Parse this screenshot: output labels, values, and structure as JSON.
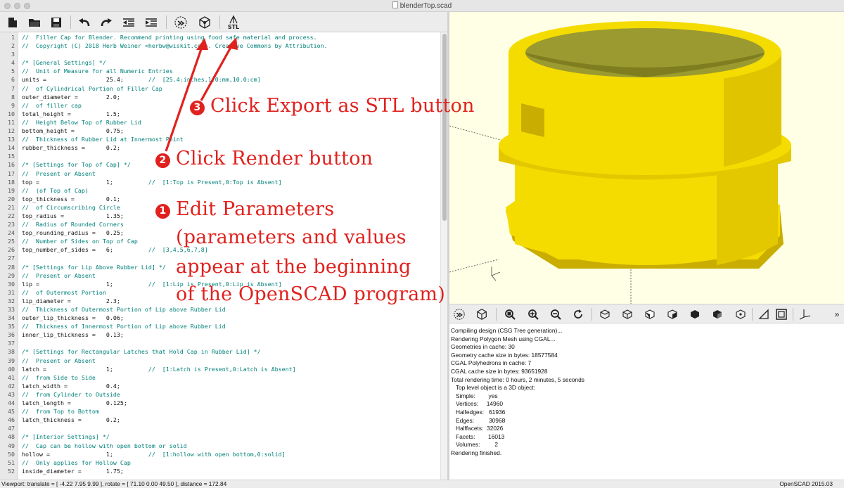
{
  "window": {
    "title": "blenderTop.scad"
  },
  "toolbar": {
    "stl_label": "STL"
  },
  "editor": {
    "lines": [
      {
        "n": "1",
        "code": "",
        "comment": "//  Filler Cap for Blender. Recommend printing using food safe material and process."
      },
      {
        "n": "2",
        "code": "",
        "comment": "//  Copyright (C) 2018 Herb Weiner <herbw@wiskit.com>. Creative Commons by Attribution."
      },
      {
        "n": "3",
        "code": "",
        "comment": ""
      },
      {
        "n": "4",
        "code": "",
        "comment": "/* [General Settings] */"
      },
      {
        "n": "5",
        "code": "",
        "comment": "//  Unit of Measure for all Numeric Entries"
      },
      {
        "n": "6",
        "code": "units =                 25.4;       ",
        "comment": "//  [25.4:inches,1.0:mm,10.0:cm]"
      },
      {
        "n": "7",
        "code": "",
        "comment": "//  of Cylindrical Portion of Filler Cap"
      },
      {
        "n": "8",
        "code": "outer_diameter =        2.0;",
        "comment": ""
      },
      {
        "n": "9",
        "code": "",
        "comment": "//  of filler cap"
      },
      {
        "n": "10",
        "code": "total_height =          1.5;",
        "comment": ""
      },
      {
        "n": "11",
        "code": "",
        "comment": "//  Height Below Top of Rubber Lid"
      },
      {
        "n": "12",
        "code": "bottom_height =         0.75;",
        "comment": ""
      },
      {
        "n": "13",
        "code": "",
        "comment": "//  Thickness of Rubber Lid at Innermost Point"
      },
      {
        "n": "14",
        "code": "rubber_thickness =      0.2;",
        "comment": ""
      },
      {
        "n": "15",
        "code": "",
        "comment": ""
      },
      {
        "n": "16",
        "code": "",
        "comment": "/* [Settings for Top of Cap] */"
      },
      {
        "n": "17",
        "code": "",
        "comment": "//  Present or Absent"
      },
      {
        "n": "18",
        "code": "top =                   1;          ",
        "comment": "//  [1:Top is Present,0:Top is Absent]"
      },
      {
        "n": "19",
        "code": "",
        "comment": "//  (of Top of Cap)"
      },
      {
        "n": "20",
        "code": "top_thickness =         0.1;",
        "comment": ""
      },
      {
        "n": "21",
        "code": "",
        "comment": "//  of Circumscribing Circle"
      },
      {
        "n": "22",
        "code": "top_radius =            1.35;",
        "comment": ""
      },
      {
        "n": "23",
        "code": "",
        "comment": "//  Radius of Rounded Corners"
      },
      {
        "n": "24",
        "code": "top_rounding_radius =   0.25;",
        "comment": ""
      },
      {
        "n": "25",
        "code": "",
        "comment": "//  Number of Sides on Top of Cap"
      },
      {
        "n": "26",
        "code": "top_number_of_sides =   6;          ",
        "comment": "//  [3,4,5,6,7,8]"
      },
      {
        "n": "27",
        "code": "",
        "comment": ""
      },
      {
        "n": "28",
        "code": "",
        "comment": "/* [Settings for Lip Above Rubber Lid] */"
      },
      {
        "n": "29",
        "code": "",
        "comment": "//  Present or Absent"
      },
      {
        "n": "30",
        "code": "lip =                   1;          ",
        "comment": "//  [1:Lip is Present,0:Lip is Absent]"
      },
      {
        "n": "31",
        "code": "",
        "comment": "//  of Outermost Portion"
      },
      {
        "n": "32",
        "code": "lip_diameter =          2.3;",
        "comment": ""
      },
      {
        "n": "33",
        "code": "",
        "comment": "//  Thickness of Outermost Portion of Lip above Rubber Lid"
      },
      {
        "n": "34",
        "code": "outer_lip_thickness =   0.06;",
        "comment": ""
      },
      {
        "n": "35",
        "code": "",
        "comment": "//  Thickness of Innermost Portion of Lip above Rubber Lid"
      },
      {
        "n": "36",
        "code": "inner_lip_thickness =   0.13;",
        "comment": ""
      },
      {
        "n": "37",
        "code": "",
        "comment": ""
      },
      {
        "n": "38",
        "code": "",
        "comment": "/* [Settings for Rectangular Latches that Hold Cap in Rubber Lid] */"
      },
      {
        "n": "39",
        "code": "",
        "comment": "//  Present or Absent"
      },
      {
        "n": "40",
        "code": "latch =                 1;          ",
        "comment": "//  [1:Latch is Present,0:Latch is Absent]"
      },
      {
        "n": "41",
        "code": "",
        "comment": "//  from Side to Side"
      },
      {
        "n": "42",
        "code": "latch_width =           0.4;",
        "comment": ""
      },
      {
        "n": "43",
        "code": "",
        "comment": "//  from Cylinder to Outside"
      },
      {
        "n": "44",
        "code": "latch_length =          0.125;",
        "comment": ""
      },
      {
        "n": "45",
        "code": "",
        "comment": "//  from Top to Bottom"
      },
      {
        "n": "46",
        "code": "latch_thickness =       0.2;",
        "comment": ""
      },
      {
        "n": "47",
        "code": "",
        "comment": ""
      },
      {
        "n": "48",
        "code": "",
        "comment": "/* [Interior Settings] */"
      },
      {
        "n": "49",
        "code": "",
        "comment": "//  Cap can be hollow with open bottom or solid"
      },
      {
        "n": "50",
        "code": "hollow =                1;          ",
        "comment": "//  [1:hollow with open bottom,0:solid]"
      },
      {
        "n": "51",
        "code": "",
        "comment": "//  Only applies for Hollow Cap"
      },
      {
        "n": "52",
        "code": "inside_diameter =       1.75;",
        "comment": ""
      }
    ]
  },
  "console": {
    "lines": [
      "Compiling design (CSG Tree generation)...",
      "Rendering Polygon Mesh using CGAL...",
      "Geometries in cache: 30",
      "Geometry cache size in bytes: 18577584",
      "CGAL Polyhedrons in cache: 7",
      "CGAL cache size in bytes: 93651928",
      "Total rendering time: 0 hours, 2 minutes, 5 seconds",
      "   Top level object is a 3D object:",
      "   Simple:        yes",
      "   Vertices:     14960",
      "   Halfedges:   61936",
      "   Edges:         30968",
      "   Halffacets:  32026",
      "   Facets:        16013",
      "   Volumes:         2",
      "Rendering finished."
    ]
  },
  "statusbar": {
    "viewport": "Viewport: translate = [ -4.22 7.95 9.99 ], rotate = [ 71.10 0.00 49.50 ], distance = 172.84",
    "version": "OpenSCAD 2015.03"
  },
  "annotations": {
    "step3_num": "3",
    "step3_text": "Click Export as STL button",
    "step2_num": "2",
    "step2_text": "Click Render button",
    "step1_num": "1",
    "step1_line1": "Edit Parameters",
    "step1_line2": "(parameters and values",
    "step1_line3": "appear at the beginning",
    "step1_line4": "of the OpenSCAD program)",
    "color": "#e0211e"
  },
  "colors": {
    "model_yellow": "#f5dc00",
    "model_shadow": "#c9ad00",
    "model_interior": "#9a9a30",
    "viewport_bg": "#ffffe5",
    "comment": "#00807a"
  },
  "viewbar": {
    "more": "»"
  }
}
